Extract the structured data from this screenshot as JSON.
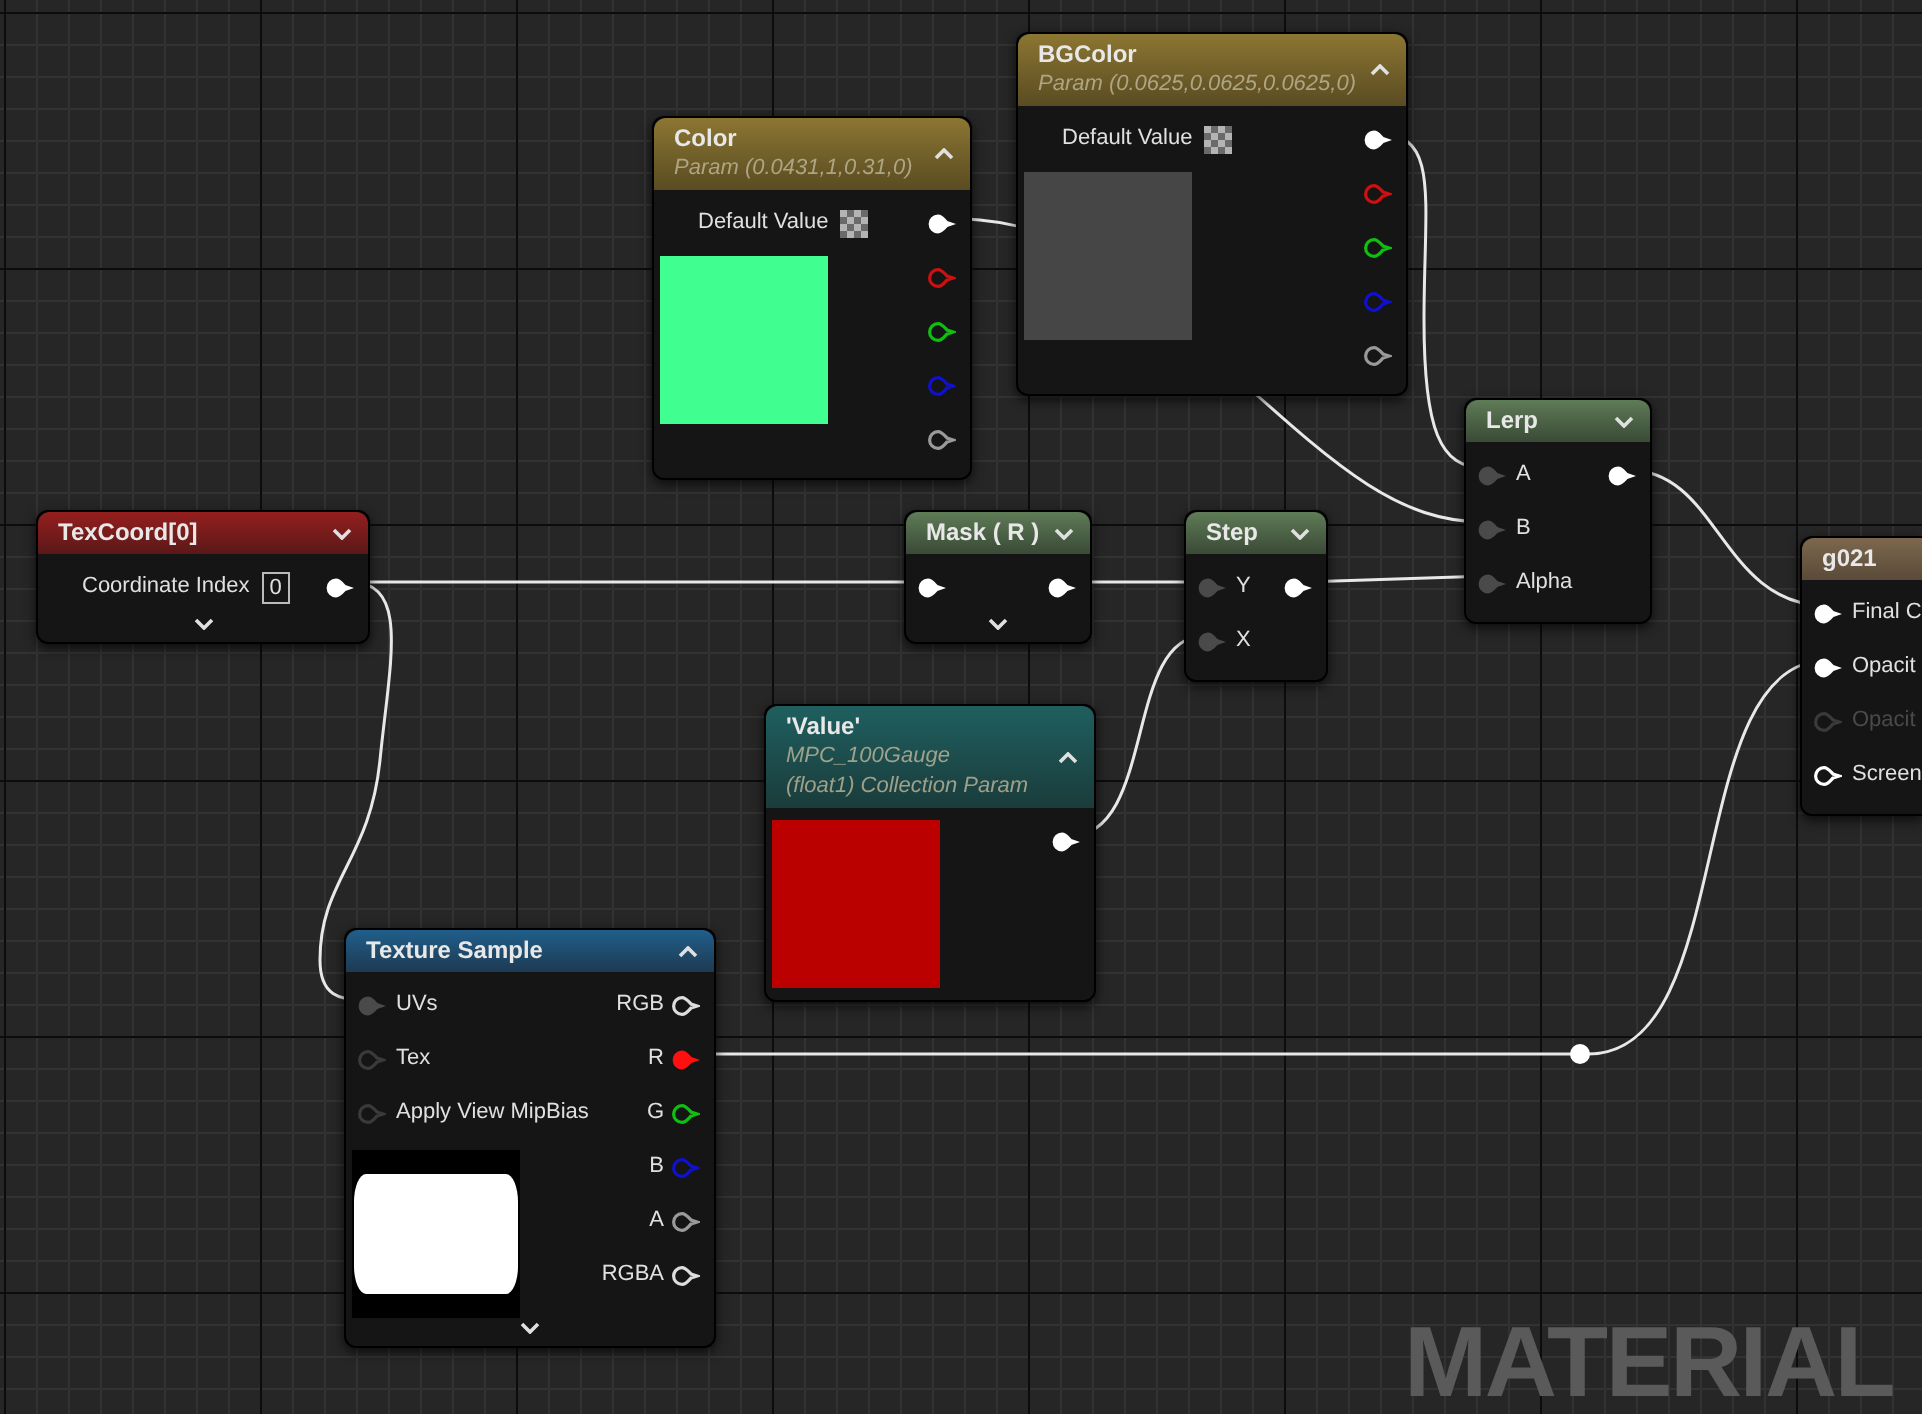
{
  "graph_label": "MATERIAL",
  "nodes": [
    {
      "kind": "param",
      "title": "Color",
      "subtitle": [
        "Param (0.0431,1,0.31,0)"
      ],
      "expanded": true,
      "property": {
        "kind": "checker",
        "label": "Default Value"
      },
      "preview": {
        "kind": "swatch",
        "color": "#40ff90"
      },
      "outputs": [
        {
          "color": "#ffffff",
          "connected": true
        },
        {
          "color": "#d01010",
          "connected": false
        },
        {
          "color": "#10c010",
          "connected": false
        },
        {
          "color": "#1010d0",
          "connected": false
        },
        {
          "color": "#9a9a9a",
          "connected": false
        }
      ]
    },
    {
      "kind": "param",
      "title": "BGColor",
      "subtitle": [
        "Param (0.0625,0.0625,0.0625,0)"
      ],
      "expanded": true,
      "property": {
        "kind": "checker",
        "label": "Default Value"
      },
      "preview": {
        "kind": "swatch",
        "color": "#464646"
      },
      "outputs": [
        {
          "color": "#ffffff",
          "connected": true
        },
        {
          "color": "#d01010",
          "connected": false
        },
        {
          "color": "#10c010",
          "connected": false
        },
        {
          "color": "#1010d0",
          "connected": false
        },
        {
          "color": "#9a9a9a",
          "connected": false
        }
      ]
    },
    {
      "kind": "coord",
      "title": "TexCoord[0]",
      "expanded": false,
      "property": {
        "kind": "field",
        "label": "Coordinate Index",
        "value": "0"
      },
      "outputs": [
        {
          "color": "#ffffff",
          "connected": true
        }
      ],
      "advanced_toggle": true
    },
    {
      "kind": "math",
      "title": "Mask ( R )",
      "expanded": false,
      "inputs": [
        {
          "color": "#ffffff",
          "connected": true
        }
      ],
      "outputs": [
        {
          "color": "#ffffff",
          "connected": true
        }
      ],
      "advanced_toggle": true
    },
    {
      "kind": "math",
      "title": "Step",
      "expanded": false,
      "inputs": [
        {
          "label": "Y",
          "color": "#4a4a4a",
          "connected": true
        },
        {
          "label": "X",
          "color": "#4a4a4a",
          "connected": true
        }
      ],
      "outputs": [
        {
          "color": "#ffffff",
          "connected": true
        }
      ]
    },
    {
      "kind": "math",
      "title": "Lerp",
      "expanded": false,
      "inputs": [
        {
          "label": "A",
          "color": "#4a4a4a",
          "connected": true
        },
        {
          "label": "B",
          "color": "#4a4a4a",
          "connected": true
        },
        {
          "label": "Alpha",
          "color": "#4a4a4a",
          "connected": true
        }
      ],
      "outputs": [
        {
          "color": "#ffffff",
          "connected": true
        }
      ]
    },
    {
      "kind": "result",
      "title": "g021",
      "inputs": [
        {
          "label": "Final C",
          "color": "#ffffff",
          "connected": true,
          "disabled": false
        },
        {
          "label": "Opacit",
          "color": "#ffffff",
          "connected": true,
          "disabled": false
        },
        {
          "label": "Opacit",
          "color": "#3a3a3a",
          "connected": false,
          "disabled": true
        },
        {
          "label": "Screen",
          "color": "#ffffff",
          "connected": false,
          "disabled": false
        }
      ]
    },
    {
      "kind": "collection",
      "title": "'Value'",
      "subtitle": [
        "MPC_100Gauge",
        "(float1) Collection Param"
      ],
      "expanded": true,
      "preview": {
        "kind": "swatch",
        "color": "#bb0000"
      },
      "outputs": [
        {
          "color": "#ffffff",
          "connected": true
        }
      ]
    },
    {
      "kind": "texture",
      "title": "Texture Sample",
      "expanded": true,
      "preview": {
        "kind": "texture"
      },
      "inputs": [
        {
          "label": "UVs",
          "color": "#4a4a4a",
          "connected": true
        },
        {
          "label": "Tex",
          "color": "#3a3a3a",
          "connected": false
        },
        {
          "label": "Apply View MipBias",
          "color": "#3a3a3a",
          "connected": false
        }
      ],
      "outputs": [
        {
          "label": "RGB",
          "color": "#dddddd",
          "connected": false
        },
        {
          "label": "R",
          "color": "#ff1010",
          "connected": true
        },
        {
          "label": "G",
          "color": "#10c010",
          "connected": false
        },
        {
          "label": "B",
          "color": "#1010d0",
          "connected": false
        },
        {
          "label": "A",
          "color": "#9a9a9a",
          "connected": false
        },
        {
          "label": "RGBA",
          "color": "#dddddd",
          "connected": false
        }
      ],
      "advanced_toggle": true
    }
  ]
}
